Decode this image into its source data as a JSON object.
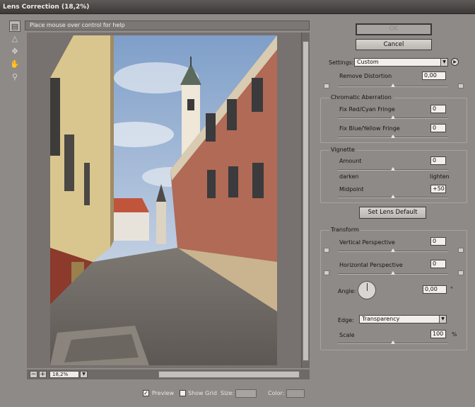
{
  "window": {
    "title": "Lens Correction (18,2%)"
  },
  "help_text": "Place mouse over control for help",
  "tools": [
    "remove-distortion-icon",
    "straighten-icon",
    "move-grid-icon",
    "hand-icon",
    "zoom-icon"
  ],
  "buttons": {
    "ok": "OK",
    "cancel": "Cancel",
    "set_lens_default": "Set Lens Default"
  },
  "settings": {
    "label": "Settings:",
    "value": "Custom"
  },
  "remove_distortion": {
    "label": "Remove Distortion",
    "value": "0,00",
    "level": 0.5
  },
  "chromatic": {
    "title": "Chromatic Aberration",
    "red_cyan": {
      "label": "Fix Red/Cyan Fringe",
      "value": "0",
      "level": 0.5
    },
    "blue_yellow": {
      "label": "Fix Blue/Yellow Fringe",
      "value": "0",
      "level": 0.5
    }
  },
  "vignette": {
    "title": "Vignette",
    "amount": {
      "label": "Amount",
      "value": "0",
      "level": 0.5
    },
    "darken": "darken",
    "lighten": "lighten",
    "midpoint": {
      "label": "Midpoint",
      "value": "+50",
      "level": 0.5
    }
  },
  "transform": {
    "title": "Transform",
    "vertical": {
      "label": "Vertical Perspective",
      "value": "0",
      "level": 0.5
    },
    "horizontal": {
      "label": "Horizontal Perspective",
      "value": "0",
      "level": 0.5
    },
    "angle": {
      "label": "Angle:",
      "value": "0,00",
      "unit": "°"
    },
    "edge": {
      "label": "Edge:",
      "value": "Transparency"
    },
    "scale": {
      "label": "Scale",
      "value": "100",
      "unit": "%",
      "level": 0.5
    }
  },
  "footer": {
    "preview": {
      "label": "Preview",
      "checked": true
    },
    "show_grid": {
      "label": "Show Grid",
      "checked": false
    },
    "size_label": "Size:",
    "color_label": "Color:"
  },
  "zoom": {
    "value": "18,2%"
  },
  "colors": {
    "dialog_bg": "#8e8a88",
    "title_bg": "#3c3938",
    "canvas_bg": "#77716f"
  }
}
